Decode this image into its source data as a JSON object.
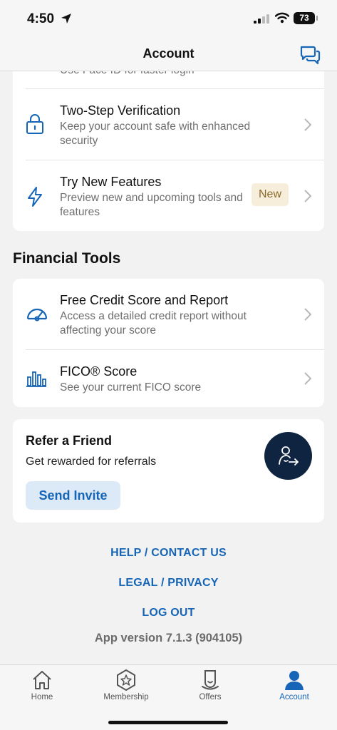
{
  "status": {
    "time": "4:50",
    "battery": "73"
  },
  "nav": {
    "title": "Account"
  },
  "security": {
    "cut_desc": "Use Face ID for faster login",
    "two_step": {
      "title": "Two-Step Verification",
      "desc": "Keep your account safe with enhanced security"
    },
    "new_features": {
      "title": "Try New Features",
      "desc": "Preview new and upcoming tools and features",
      "badge": "New"
    }
  },
  "financial_tools": {
    "heading": "Financial Tools",
    "credit": {
      "title": "Free Credit Score and Report",
      "desc": "Access a detailed credit report without affecting your score"
    },
    "fico": {
      "title": "FICO® Score",
      "desc": "See your current FICO score"
    }
  },
  "refer": {
    "title": "Refer a Friend",
    "subtitle": "Get rewarded for referrals",
    "button": "Send Invite"
  },
  "links": {
    "help": "HELP / CONTACT US",
    "legal": "LEGAL / PRIVACY",
    "logout": "LOG OUT"
  },
  "version": "App version 7.1.3 (904105)",
  "tabs": {
    "home": "Home",
    "membership": "Membership",
    "offers": "Offers",
    "account": "Account"
  },
  "colors": {
    "accent": "#1665b6",
    "dark_navy": "#0f2440",
    "badge_bg": "#f6eedb"
  }
}
